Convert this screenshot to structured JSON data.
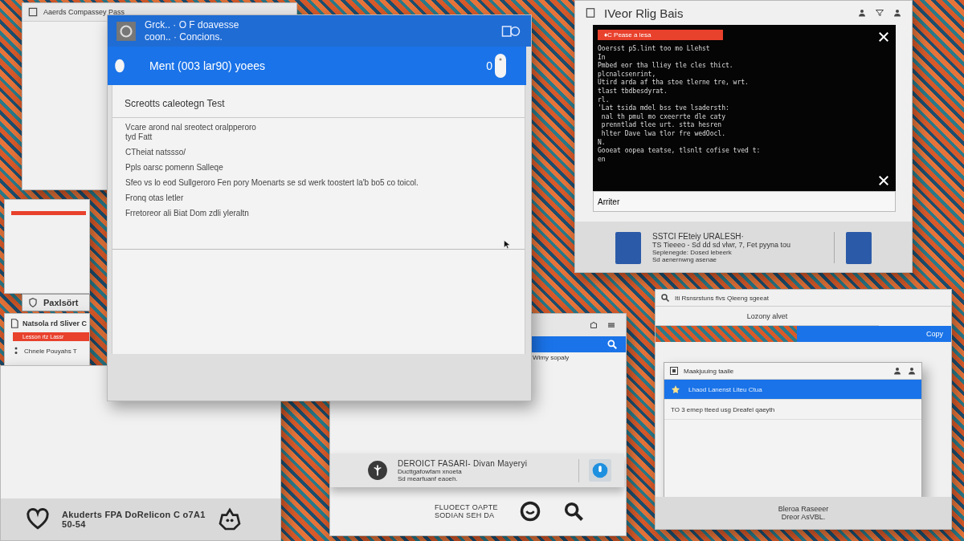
{
  "back_window": {
    "title": "Aaerds Compassey Pass"
  },
  "left_window": {
    "tab": "Paxlsört",
    "title": "Natsola rd Sliver C",
    "highlight": "Lesson rtz Lassr",
    "item": "Chnele Pouyahs T"
  },
  "bottom_left_window": {
    "footer_lines": [
      "Akuderts FPA DoRelicon C o7A1",
      "50-54"
    ]
  },
  "main_window": {
    "title_lines": [
      "Grck.. · O F doavesse",
      "coon.. · Concions."
    ],
    "header": "Ment (003 lar90) yoees",
    "header_count": "0",
    "heading": "Screotts caleotegn Test",
    "lines": [
      "Vcare arond nal sreotect oralpperoro",
      "tyd Fatt",
      "CTheiat natssso/",
      "Ppls oarsc pomenn Salleqe",
      "Sfeo vs lo eod Sullgeroro Fen pory Moenarts se sd werk toostert la'b bo5 co toicol.",
      "Fronq otas letler",
      "Frretoreor ali Biat Dom zdli yleraltn"
    ]
  },
  "terminal_window": {
    "title": "IVeor Rlig Bais",
    "alert": "♦C  Pease a lesa",
    "lines": [
      "Ooersst pS.lint too mo Llehst",
      "In",
      "Pmbed eor tha lliey tle cles thict.",
      "plcnalcsenrint,",
      "Utird arda af tha stoe tlerne tre, wrt.",
      "tlast tbdbesdyrat.",
      "rl.",
      "'Lat tsida mdel bss tve lsadersth:",
      " nal th pmul mo cxeerrte dle caty",
      " prenntlad tlee urt. stta hesren",
      " hlter Dave lwa tlor fre wedOocl.",
      "N.",
      "Gooeat oopea teatse, tlsnlt cofise tved t:",
      "en"
    ],
    "input": "Arriter",
    "contact_name": "SSTCI FEteiy URALESH·",
    "contact_detail": "TS Tieeeo - Sd dd sd vlwr, 7, Fet pyyna tou",
    "contact_notes": [
      "Seplenegde: Dosed lebeerk",
      "Sd aenernwng asenae"
    ]
  },
  "search_window": {
    "result": "Wimy sopaly",
    "footer_title": "DEROICT FASARI- Divan Mayeryi",
    "footer_lines": [
      "Ducttgafowfam xnoeta",
      "Sd mearfuanf eaoeh."
    ],
    "bottom_lines": [
      "FLUOECT OAPTE",
      "SODIAN SEH DA"
    ]
  },
  "right_window": {
    "search": "Iti Rsnsrstuns flvs Qleeng sgeeat",
    "subtitle": "Lozony alvet",
    "action": "Copy",
    "dialog": {
      "title": "Maakjuuing taalle",
      "rows": [
        {
          "label": "Lhaod Lanenst Liteu Ctua",
          "selected": true
        },
        {
          "label": "TO 3 emep tteed usg Dreafel qaeyth",
          "selected": false
        }
      ]
    },
    "footer_lines": [
      "Bleroa Raseeer",
      "Dreor AsVBL."
    ]
  }
}
